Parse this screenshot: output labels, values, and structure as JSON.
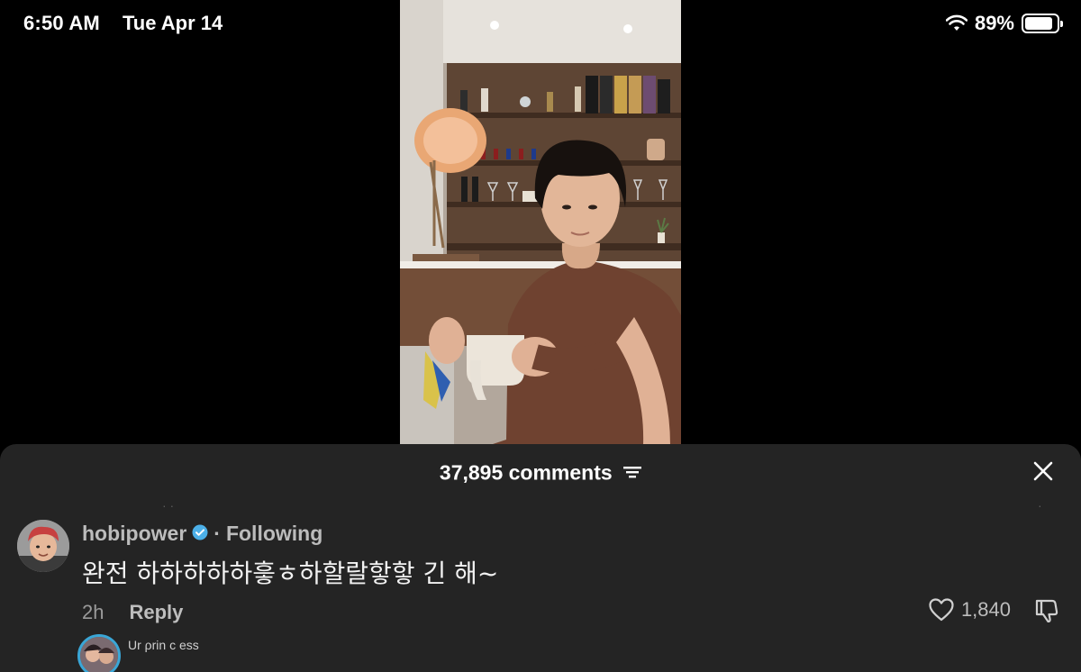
{
  "status_bar": {
    "time": "6:50 AM",
    "date": "Tue Apr 14",
    "battery": "89%",
    "battery_level": 0.89
  },
  "comments_panel": {
    "count_label": "37,895 comments"
  },
  "comment": {
    "username": "hobipower",
    "verified": true,
    "separator": "·",
    "relation": "Following",
    "text": "완전 하하하하하흫ㅎ하할랄핳핳 긴 해~",
    "age": "2h",
    "reply_label": "Reply",
    "likes": "1,840"
  },
  "next_comment": {
    "username": "Ur  ρrin c ess"
  },
  "colors": {
    "sheet_background": "#242424",
    "verified_badge": "#4cb0e8",
    "story_ring": "#3aa6d6"
  }
}
